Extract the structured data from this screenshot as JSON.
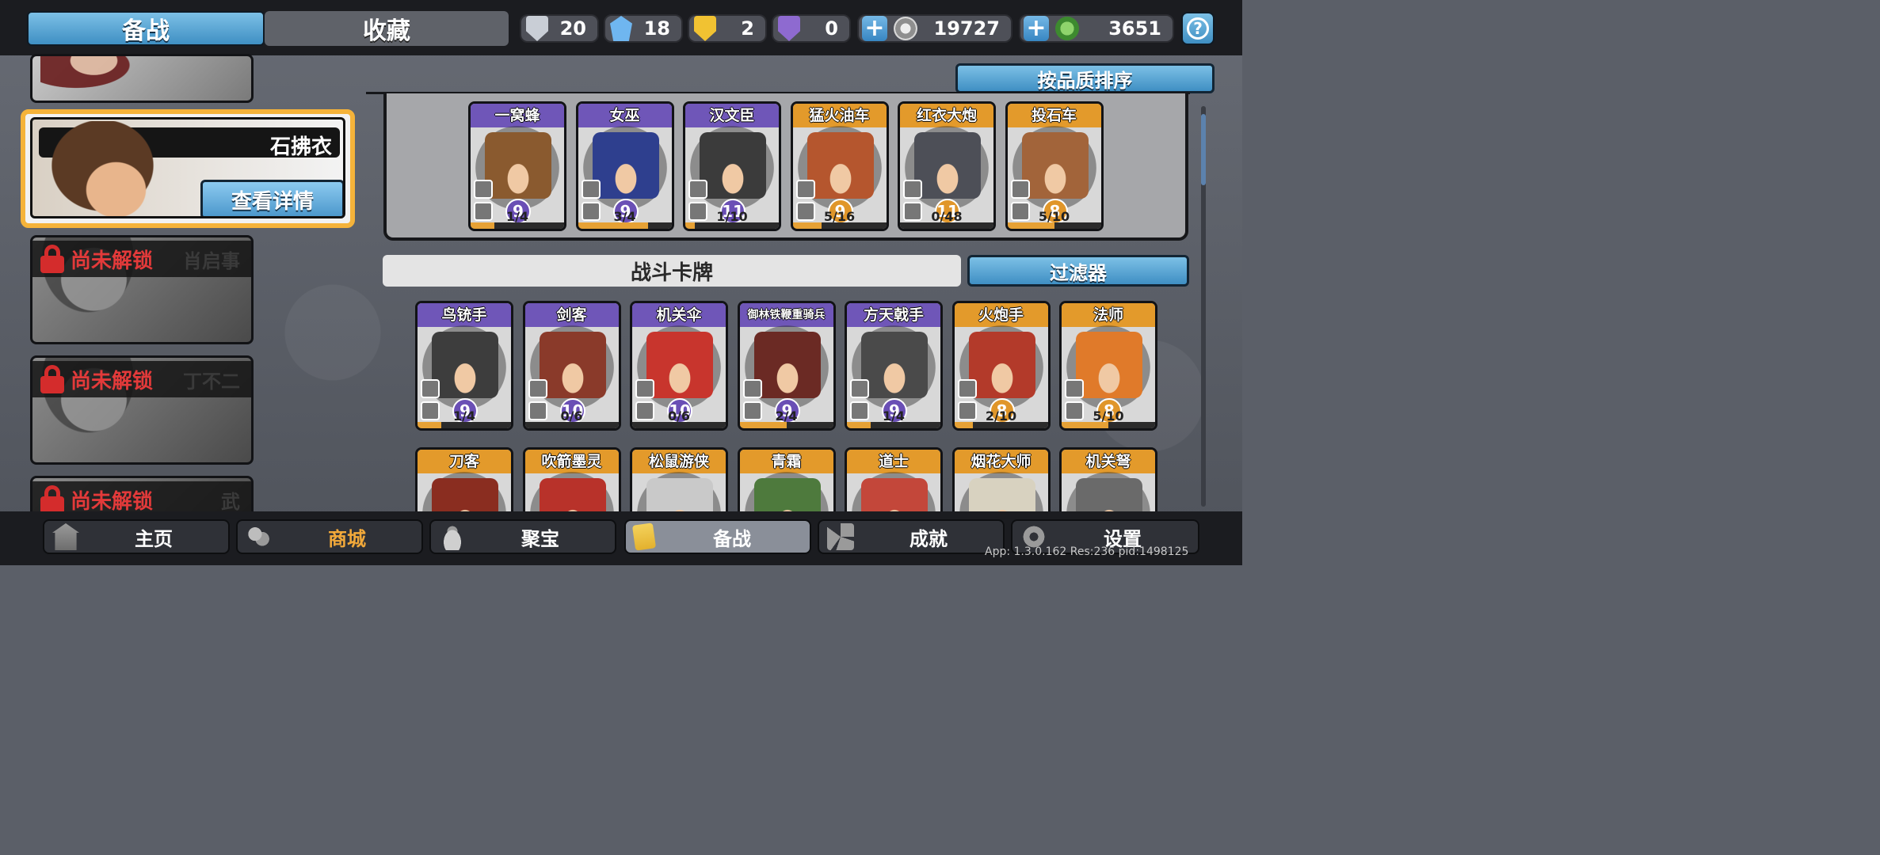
{
  "tabs": {
    "active": "备战",
    "inactive": "收藏"
  },
  "resources": [
    {
      "icon": "silver-shield-icon",
      "value": "20",
      "color": "#c9ced6"
    },
    {
      "icon": "blue-crystal-icon",
      "value": "18",
      "color": "#6fb6f0"
    },
    {
      "icon": "gold-shield-icon",
      "value": "2",
      "color": "#f1c232"
    },
    {
      "icon": "purple-shield-icon",
      "value": "0",
      "color": "#8e6ad0"
    }
  ],
  "currency": [
    {
      "icon": "silver-coin-icon",
      "value": "19727",
      "color": "#c7c7c7"
    },
    {
      "icon": "jade-coin-icon",
      "value": "3651",
      "color": "#5fae4a"
    }
  ],
  "help_icon": "question-icon",
  "heroes": {
    "selected": {
      "name": "石拂衣",
      "detail_button": "查看详情"
    },
    "locked_label": "尚未解锁",
    "locked": [
      {
        "name": "肖启事"
      },
      {
        "name": "丁不二"
      },
      {
        "name": "武"
      }
    ]
  },
  "sort_button": "按品质排序",
  "deck": [
    {
      "name": "一窝蜂",
      "level": "9",
      "count": "1/4",
      "progress": 0.25,
      "rarity": "purple",
      "color": "#8a5a2f"
    },
    {
      "name": "女巫",
      "level": "9",
      "count": "3/4",
      "progress": 0.75,
      "rarity": "purple",
      "color": "#2e3f8e"
    },
    {
      "name": "汉文臣",
      "level": "11",
      "count": "1/10",
      "progress": 0.1,
      "rarity": "purple",
      "color": "#3b3b3b"
    },
    {
      "name": "猛火油车",
      "level": "9",
      "count": "5/16",
      "progress": 0.31,
      "rarity": "orange",
      "color": "#b5562e"
    },
    {
      "name": "红衣大炮",
      "level": "11",
      "count": "0/48",
      "progress": 0.0,
      "rarity": "orange",
      "color": "#4d4f57"
    },
    {
      "name": "投石车",
      "level": "8",
      "count": "5/10",
      "progress": 0.5,
      "rarity": "orange",
      "color": "#a2643a"
    }
  ],
  "battle_cards_title": "战斗卡牌",
  "filter_button": "过滤器",
  "cards": [
    {
      "name": "鸟铳手",
      "level": "9",
      "count": "1/4",
      "progress": 0.25,
      "rarity": "purple",
      "color": "#3d3d3d"
    },
    {
      "name": "剑客",
      "level": "10",
      "count": "0/6",
      "progress": 0.0,
      "rarity": "purple",
      "color": "#8a3a2a"
    },
    {
      "name": "机关伞",
      "level": "10",
      "count": "0/6",
      "progress": 0.0,
      "rarity": "purple",
      "color": "#c8352d"
    },
    {
      "name": "御林铁鞭重骑兵",
      "level": "9",
      "count": "2/4",
      "progress": 0.5,
      "rarity": "purple",
      "color": "#6b2a24"
    },
    {
      "name": "方天戟手",
      "level": "9",
      "count": "1/4",
      "progress": 0.25,
      "rarity": "purple",
      "color": "#4a4a4a"
    },
    {
      "name": "火炮手",
      "level": "8",
      "count": "2/10",
      "progress": 0.2,
      "rarity": "orange",
      "color": "#b33a2a"
    },
    {
      "name": "法师",
      "level": "8",
      "count": "5/10",
      "progress": 0.5,
      "rarity": "orange",
      "color": "#e07a2a"
    }
  ],
  "cards_row2": [
    {
      "name": "刀客",
      "rarity": "orange",
      "color": "#8a2d20"
    },
    {
      "name": "吹箭墨灵",
      "rarity": "orange",
      "color": "#b8322a"
    },
    {
      "name": "松鼠游侠",
      "rarity": "orange",
      "color": "#c9c9c9"
    },
    {
      "name": "青霜",
      "rarity": "orange",
      "color": "#4e7a3d"
    },
    {
      "name": "道士",
      "rarity": "orange",
      "color": "#c3473a"
    },
    {
      "name": "烟花大师",
      "rarity": "orange",
      "color": "#d8d2c0"
    },
    {
      "name": "机关弩",
      "rarity": "orange",
      "color": "#6a6a6a"
    }
  ],
  "nav": [
    {
      "label": "主页",
      "icon": "home-icon"
    },
    {
      "label": "商城",
      "icon": "coins-icon"
    },
    {
      "label": "聚宝",
      "icon": "treasure-bowl-icon"
    },
    {
      "label": "备战",
      "icon": "cards-icon"
    },
    {
      "label": "成就",
      "icon": "achievements-icon"
    },
    {
      "label": "设置",
      "icon": "gear-icon"
    }
  ],
  "version_text": "App: 1.3.0.162 Res:236 pid:1498125"
}
